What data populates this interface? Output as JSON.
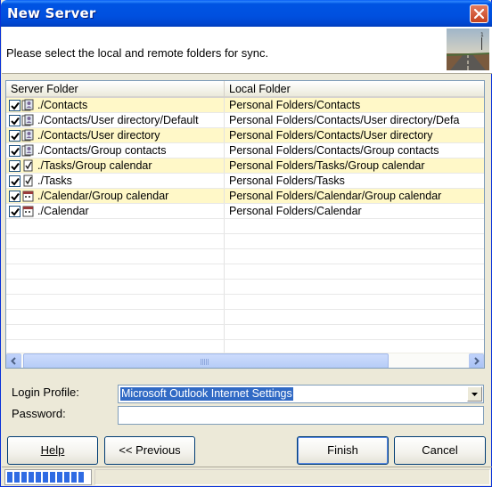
{
  "window": {
    "title": "New Server"
  },
  "header": {
    "text": "Please select the local and remote folders for sync."
  },
  "list": {
    "columns": {
      "server": "Server Folder",
      "local": "Local Folder"
    },
    "rows": [
      {
        "server": "./Contacts",
        "local": "Personal Folders/Contacts",
        "icon": "contacts-icon"
      },
      {
        "server": "./Contacts/User directory/Default",
        "local": "Personal Folders/Contacts/User directory/Defa",
        "icon": "contacts-icon"
      },
      {
        "server": "./Contacts/User directory",
        "local": "Personal Folders/Contacts/User directory",
        "icon": "contacts-icon"
      },
      {
        "server": "./Contacts/Group contacts",
        "local": "Personal Folders/Contacts/Group contacts",
        "icon": "contacts-icon"
      },
      {
        "server": "./Tasks/Group calendar",
        "local": "Personal Folders/Tasks/Group calendar",
        "icon": "tasks-icon"
      },
      {
        "server": "./Tasks",
        "local": "Personal Folders/Tasks",
        "icon": "tasks-icon"
      },
      {
        "server": "./Calendar/Group calendar",
        "local": "Personal Folders/Calendar/Group calendar",
        "icon": "calendar-icon"
      },
      {
        "server": "./Calendar",
        "local": "Personal Folders/Calendar",
        "icon": "calendar-icon"
      }
    ]
  },
  "form": {
    "login_profile_label": "Login Profile:",
    "login_profile_value": "Microsoft Outlook Internet Settings",
    "password_label": "Password:",
    "password_value": ""
  },
  "buttons": {
    "help": "Help",
    "previous": "<< Previous",
    "finish": "Finish",
    "cancel": "Cancel"
  },
  "progress": {
    "fraction": 0.95
  },
  "colors": {
    "titlebar": "#0054e3",
    "row_highlight": "#fff8c8",
    "selection": "#316ac5"
  }
}
